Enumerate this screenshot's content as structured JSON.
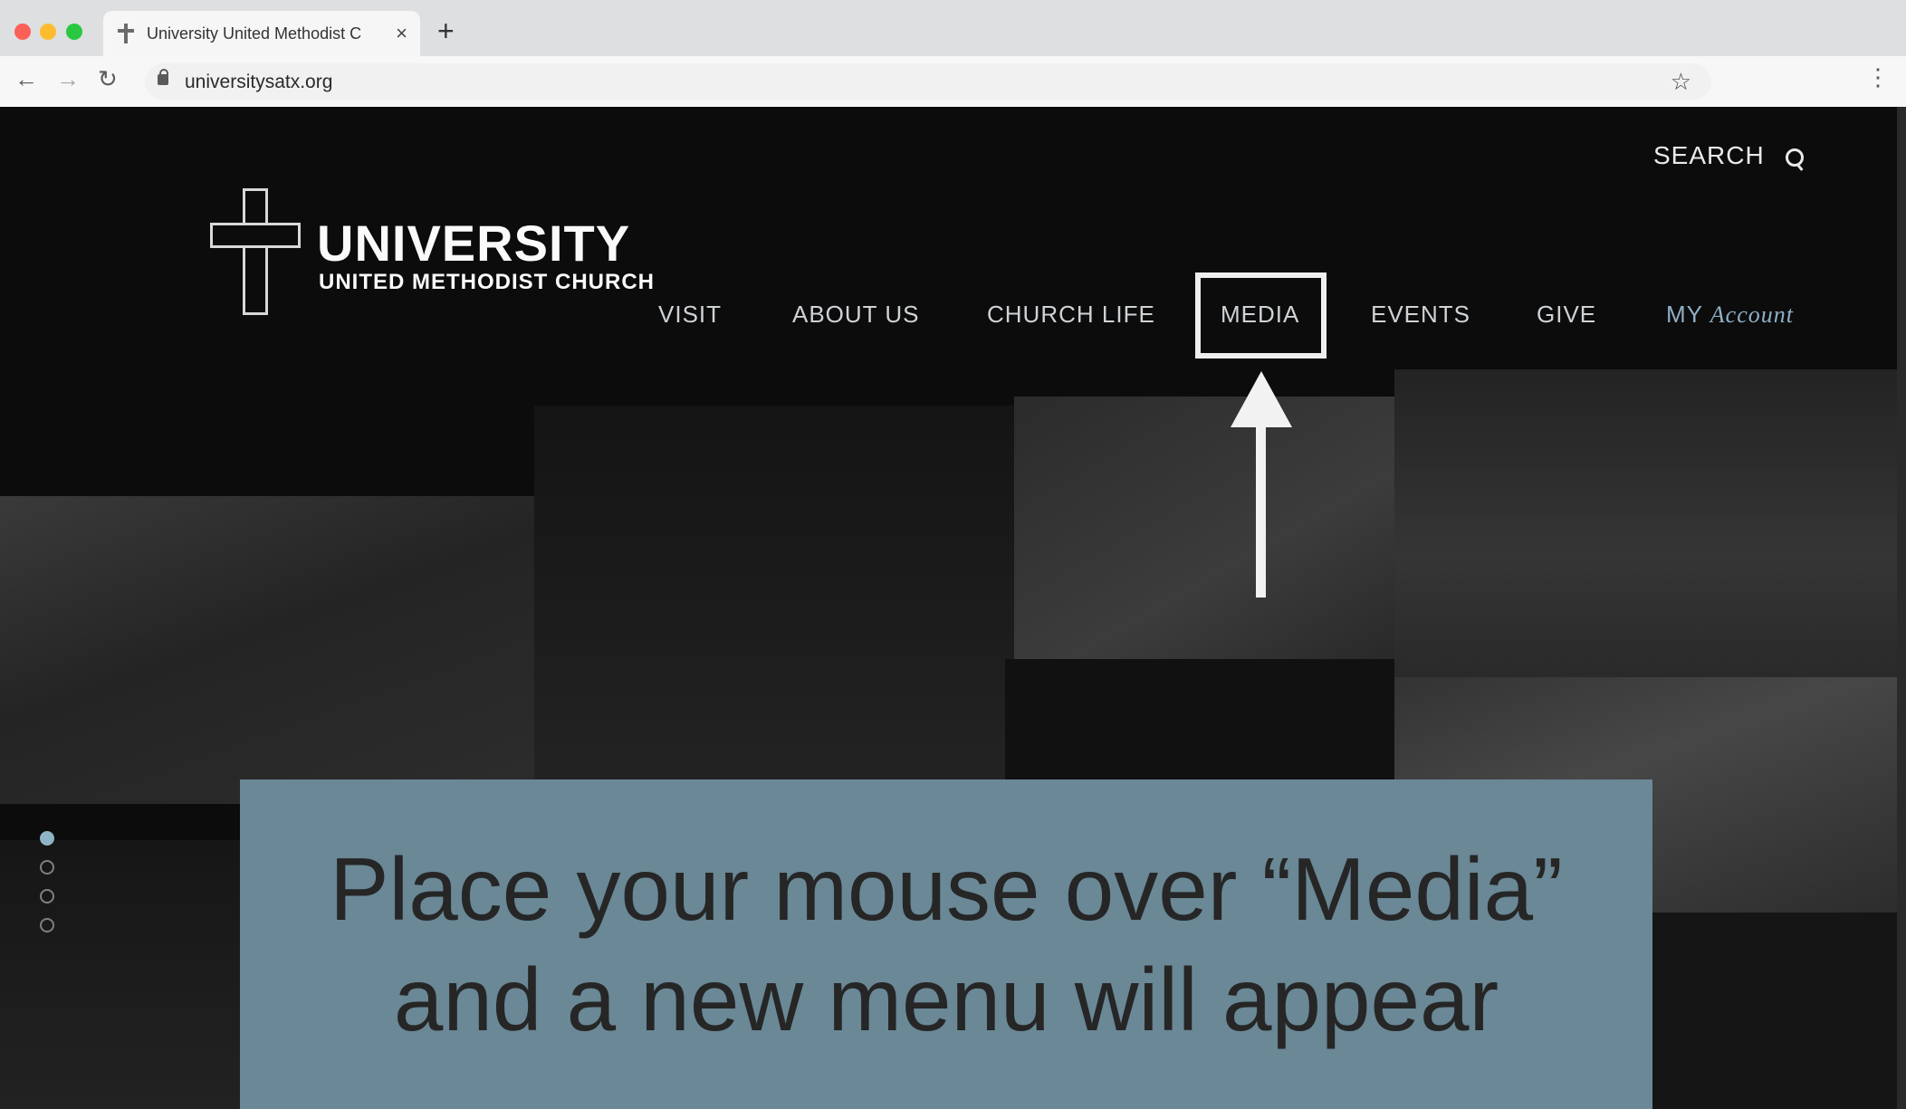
{
  "browser": {
    "tab_title": "University United Methodist C",
    "tab_close": "×",
    "new_tab": "+",
    "url": "universitysatx.org",
    "back": "←",
    "forward": "→",
    "reload": "↻",
    "bookmark": "☆",
    "menu": "⋮"
  },
  "site": {
    "search_label": "SEARCH",
    "logo": {
      "name": "UNIVERSITY",
      "subtitle": "UNITED METHODIST CHURCH"
    },
    "nav": {
      "visit": "VISIT",
      "about": "ABOUT US",
      "church_life": "CHURCH LIFE",
      "media": "MEDIA",
      "events": "EVENTS",
      "give": "GIVE",
      "my": "MY",
      "account": "Account"
    },
    "slider": {
      "count": 4,
      "active_index": 0
    }
  },
  "annotation": {
    "line1": "Place your mouse over “Media”",
    "line2": "and a new menu will appear"
  },
  "colors": {
    "accent": "#8eb4c6",
    "callout_bg": "#6a8896",
    "highlight": "#efefef"
  },
  "icons": [
    "close-icon",
    "plus-icon",
    "back-arrow-icon",
    "forward-arrow-icon",
    "reload-icon",
    "lock-icon",
    "star-icon",
    "kebab-menu-icon",
    "search-icon",
    "cross-logo-icon",
    "up-arrow-icon"
  ]
}
